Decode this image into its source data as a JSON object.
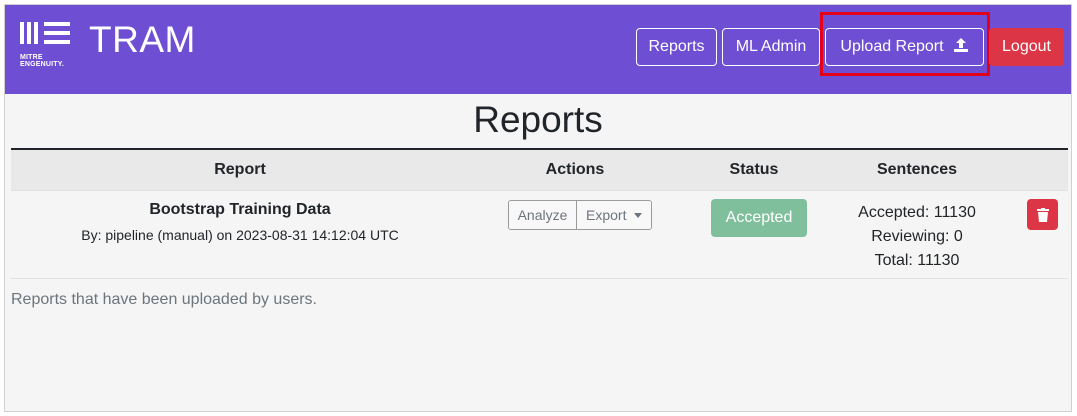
{
  "brand": {
    "logo_text": "MITRE ENGENUITY.",
    "app_name": "TRAM"
  },
  "nav": {
    "reports": "Reports",
    "ml_admin": "ML Admin",
    "upload_report": "Upload Report",
    "logout": "Logout"
  },
  "page": {
    "title": "Reports",
    "footnote": "Reports that have been uploaded by users."
  },
  "table": {
    "headers": [
      "Report",
      "Actions",
      "Status",
      "Sentences"
    ],
    "rows": [
      {
        "title": "Bootstrap Training Data",
        "meta": "By: pipeline (manual) on 2023-08-31 14:12:04 UTC",
        "actions": [
          "Analyze",
          "Export"
        ],
        "status": "Accepted",
        "sentences": {
          "accepted": "Accepted: 11130",
          "reviewing": "Reviewing: 0",
          "total": "Total: 11130"
        }
      }
    ]
  },
  "colors": {
    "navbar": "#6e4fd3",
    "danger": "#dc3545",
    "accepted": "#7fbf9c",
    "highlight": "#e3001b"
  },
  "icons": {
    "upload": "upload-icon",
    "delete": "trash-icon",
    "dropdown": "caret-down-icon",
    "logo": "mitre-engenuity-logo"
  }
}
